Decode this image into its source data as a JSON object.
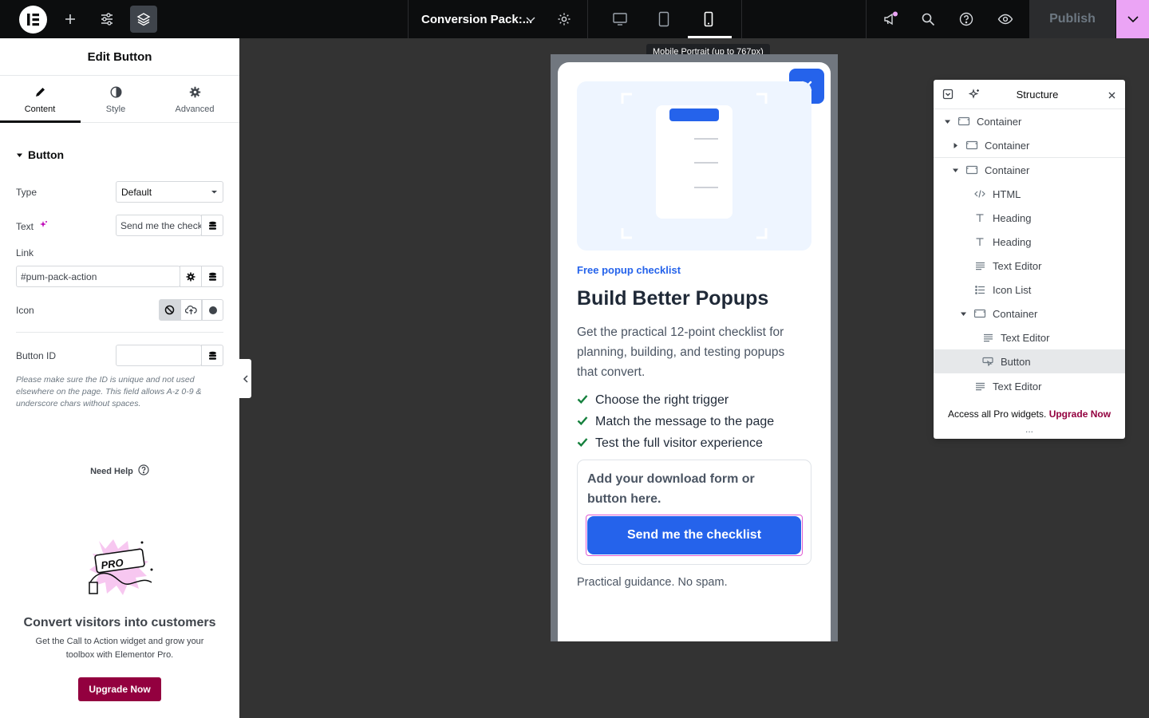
{
  "topbar": {
    "document_title": "Conversion Pack:...",
    "publish_label": "Publish",
    "device_tooltip": "Mobile Portrait (up to 767px)"
  },
  "panel": {
    "title": "Edit Button",
    "tabs": [
      {
        "label": "Content",
        "icon": "pencil-icon"
      },
      {
        "label": "Style",
        "icon": "half-circle-icon"
      },
      {
        "label": "Advanced",
        "icon": "gear-icon"
      }
    ],
    "section_title": "Button",
    "type_label": "Type",
    "type_value": "Default",
    "text_label": "Text",
    "text_value": "Send me the checklist",
    "link_label": "Link",
    "link_value": "#pum-pack-action",
    "icon_label": "Icon",
    "button_id_label": "Button ID",
    "button_id_value": "",
    "note": "Please make sure the ID is unique and not used elsewhere on the page. This field allows A-z  0-9 & underscore chars without spaces.",
    "need_help": "Need Help",
    "promo_badge": "PRO",
    "promo_title": "Convert visitors into customers",
    "promo_text": "Get the Call to Action widget and grow your toolbox with Elementor Pro.",
    "upgrade_label": "Upgrade Now"
  },
  "popup": {
    "kicker": "Free popup checklist",
    "title": "Build Better Popups",
    "body": "Get the practical 12-point checklist for planning, building, and testing popups that convert.",
    "checklist": [
      "Choose the right trigger",
      "Match the message to the page",
      "Test the full visitor experience"
    ],
    "form_hint": "Add your download form or button here.",
    "cta_label": "Send me the checklist",
    "foot_note": "Practical guidance. No spam."
  },
  "structure": {
    "title": "Structure",
    "items": [
      {
        "label": "Container"
      },
      {
        "label": "Container"
      },
      {
        "label": "Container"
      },
      {
        "label": "HTML"
      },
      {
        "label": "Heading"
      },
      {
        "label": "Heading"
      },
      {
        "label": "Text Editor"
      },
      {
        "label": "Icon List"
      },
      {
        "label": "Container"
      },
      {
        "label": "Text Editor"
      },
      {
        "label": "Button"
      },
      {
        "label": "Text Editor"
      }
    ],
    "footer_text": "Access all Pro widgets.",
    "footer_link": "Upgrade Now",
    "more": "..."
  },
  "colors": {
    "accent_blue": "#2563eb",
    "pro_magenta": "#93003f",
    "publish_caret_pink": "#eba4f5",
    "check_green": "#15803d"
  }
}
